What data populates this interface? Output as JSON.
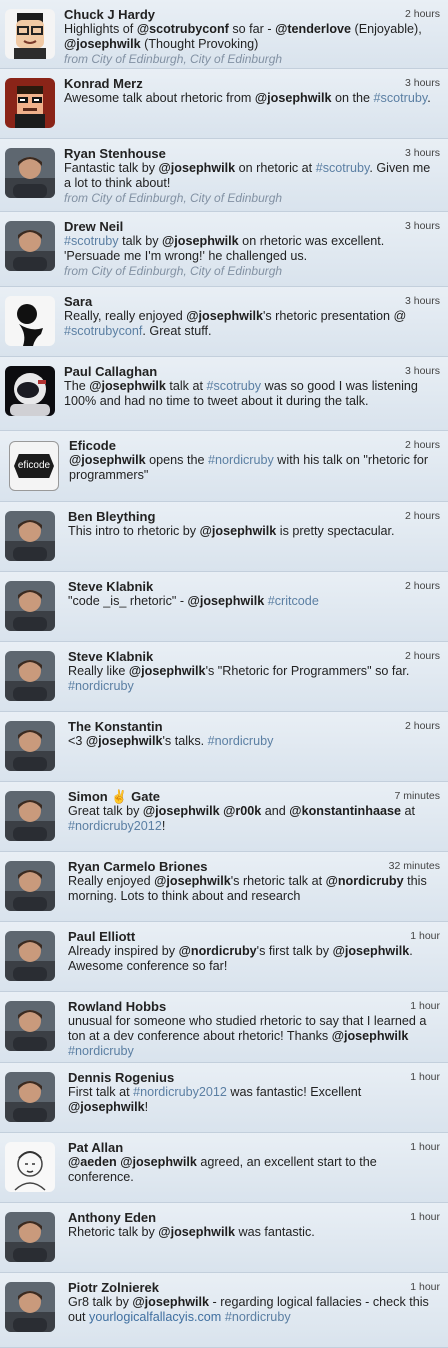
{
  "tweets": [
    {
      "name": "Chuck J Hardy",
      "time": "2 hours",
      "avatar": "cartoon-avatar",
      "h": 69,
      "text": [
        [
          "t",
          "Highlights of "
        ],
        [
          "m",
          "@scotrubyconf"
        ],
        [
          "t",
          " so far - "
        ],
        [
          "m",
          "@tenderlove"
        ],
        [
          "t",
          " (Enjoyable), "
        ],
        [
          "m",
          "@josephwilk"
        ],
        [
          "t",
          " (Thought Provoking)"
        ]
      ],
      "location": "from City of Edinburgh, City of Edinburgh"
    },
    {
      "name": "Konrad Merz",
      "time": "3 hours",
      "avatar": "pixel-art-avatar",
      "h": 70,
      "text": [
        [
          "t",
          "Awesome talk about rhetoric from "
        ],
        [
          "m",
          "@josephwilk"
        ],
        [
          "t",
          " on the "
        ],
        [
          "h",
          "#scotruby"
        ],
        [
          "t",
          "."
        ]
      ]
    },
    {
      "name": "Ryan Stenhouse",
      "time": "3 hours",
      "avatar": "photo-avatar",
      "h": 73,
      "text": [
        [
          "t",
          "Fantastic talk by "
        ],
        [
          "m",
          "@josephwilk"
        ],
        [
          "t",
          " on rhetoric at "
        ],
        [
          "h",
          "#scotruby"
        ],
        [
          "t",
          ". Given me a lot to think about!"
        ]
      ],
      "location": "from City of Edinburgh, City of Edinburgh"
    },
    {
      "name": "Drew Neil",
      "time": "3 hours",
      "avatar": "photo-avatar",
      "h": 75,
      "text": [
        [
          "h",
          "#scotruby"
        ],
        [
          "t",
          " talk by "
        ],
        [
          "m",
          "@josephwilk"
        ],
        [
          "t",
          " on rhetoric was excellent. 'Persuade me I'm wrong!' he challenged us."
        ]
      ],
      "location": "from City of Edinburgh, City of Edinburgh"
    },
    {
      "name": "Sara",
      "time": "3 hours",
      "avatar": "silhouette-avatar",
      "h": 70,
      "text": [
        [
          "t",
          "Really, really enjoyed "
        ],
        [
          "m",
          "@josephwilk"
        ],
        [
          "t",
          "'s rhetoric presentation @ "
        ],
        [
          "h",
          "#scotrubyconf"
        ],
        [
          "t",
          ". Great stuff."
        ]
      ]
    },
    {
      "name": "Paul Callaghan",
      "time": "3 hours",
      "avatar": "helmet-avatar",
      "h": 74,
      "text": [
        [
          "t",
          "The "
        ],
        [
          "m",
          "@josephwilk"
        ],
        [
          "t",
          " talk at "
        ],
        [
          "h",
          "#scotruby"
        ],
        [
          "t",
          " was so good I was listening 100% and had no time to tweet about it during the talk."
        ]
      ]
    },
    {
      "name": "Eficode",
      "time": "2 hours",
      "avatar": "eficode-logo",
      "logo_text": "eficode",
      "h": 71,
      "text": [
        [
          "m",
          "@josephwilk"
        ],
        [
          "t",
          " opens the "
        ],
        [
          "h",
          "#nordicruby"
        ],
        [
          "t",
          " with his talk on \"rhetoric for programmers\""
        ]
      ]
    },
    {
      "name": "Ben Bleything",
      "time": "2 hours",
      "avatar": "photo-avatar",
      "h": 70,
      "text": [
        [
          "t",
          "This intro to rhetoric by "
        ],
        [
          "m",
          "@josephwilk"
        ],
        [
          "t",
          " is pretty spectacular."
        ]
      ]
    },
    {
      "name": "Steve Klabnik",
      "time": "2 hours",
      "avatar": "photo-avatar",
      "h": 70,
      "text": [
        [
          "t",
          "\"code _is_ rhetoric\" - "
        ],
        [
          "m",
          "@josephwilk"
        ],
        [
          "t",
          " "
        ],
        [
          "h",
          "#critcode"
        ]
      ]
    },
    {
      "name": "Steve Klabnik",
      "time": "2 hours",
      "avatar": "photo-avatar",
      "h": 70,
      "text": [
        [
          "t",
          "Really like "
        ],
        [
          "m",
          "@josephwilk"
        ],
        [
          "t",
          "'s \"Rhetoric for Programmers\" so far. "
        ],
        [
          "h",
          "#nordicruby"
        ]
      ]
    },
    {
      "name": "The Konstantin",
      "time": "2 hours",
      "avatar": "photo-avatar",
      "h": 70,
      "text": [
        [
          "t",
          "<3 "
        ],
        [
          "m",
          "@josephwilk"
        ],
        [
          "t",
          "'s talks. "
        ],
        [
          "h",
          "#nordicruby"
        ]
      ]
    },
    {
      "name": "Simon ✌ Gate",
      "time": "7 minutes",
      "avatar": "photo-avatar",
      "h": 70,
      "text": [
        [
          "t",
          "Great talk by "
        ],
        [
          "m",
          "@josephwilk"
        ],
        [
          "t",
          " "
        ],
        [
          "m",
          "@r00k"
        ],
        [
          "t",
          " and "
        ],
        [
          "m",
          "@konstantinhaase"
        ],
        [
          "t",
          " at "
        ],
        [
          "h",
          "#nordicruby2012"
        ],
        [
          "t",
          "!"
        ]
      ]
    },
    {
      "name": "Ryan Carmelo Briones",
      "time": "32 minutes",
      "avatar": "photo-avatar",
      "h": 70,
      "text": [
        [
          "t",
          "Really enjoyed "
        ],
        [
          "m",
          "@josephwilk"
        ],
        [
          "t",
          "'s rhetoric talk at "
        ],
        [
          "m",
          "@nordicruby"
        ],
        [
          "t",
          " this morning. Lots to think about and research"
        ]
      ]
    },
    {
      "name": "Paul Elliott",
      "time": "1 hour",
      "avatar": "photo-avatar",
      "h": 70,
      "text": [
        [
          "t",
          "Already inspired by "
        ],
        [
          "m",
          "@nordicruby"
        ],
        [
          "t",
          "'s first talk by "
        ],
        [
          "m",
          "@josephwilk"
        ],
        [
          "t",
          ". Awesome conference so far!"
        ]
      ]
    },
    {
      "name": "Rowland Hobbs",
      "time": "1 hour",
      "avatar": "photo-avatar",
      "h": 71,
      "text": [
        [
          "t",
          "unusual for someone who studied rhetoric to say that I learned a ton at a dev conference about rhetoric! Thanks "
        ],
        [
          "m",
          "@josephwilk"
        ],
        [
          "t",
          " "
        ],
        [
          "h",
          "#nordicruby"
        ]
      ]
    },
    {
      "name": "Dennis Rogenius",
      "time": "1 hour",
      "avatar": "photo-avatar",
      "h": 70,
      "text": [
        [
          "t",
          "First talk at "
        ],
        [
          "h",
          "#nordicruby2012"
        ],
        [
          "t",
          " was fantastic! Excellent "
        ],
        [
          "m",
          "@josephwilk"
        ],
        [
          "t",
          "!"
        ]
      ]
    },
    {
      "name": "Pat Allan",
      "time": "1 hour",
      "avatar": "sketch-avatar",
      "h": 70,
      "text": [
        [
          "m",
          "@aeden"
        ],
        [
          "t",
          " "
        ],
        [
          "m",
          "@josephwilk"
        ],
        [
          "t",
          " agreed, an excellent start to the conference."
        ]
      ]
    },
    {
      "name": "Anthony Eden",
      "time": "1 hour",
      "avatar": "photo-avatar",
      "h": 70,
      "text": [
        [
          "t",
          "Rhetoric talk by "
        ],
        [
          "m",
          "@josephwilk"
        ],
        [
          "t",
          " was fantastic."
        ]
      ]
    },
    {
      "name": "Piotr Zolnierek",
      "time": "1 hour",
      "avatar": "photo-avatar",
      "h": 75,
      "text": [
        [
          "t",
          "Gr8 talk by "
        ],
        [
          "m",
          "@josephwilk"
        ],
        [
          "t",
          " - regarding logical fallacies - check this out "
        ],
        [
          "l",
          "yourlogicalfallacyis.com"
        ],
        [
          "t",
          " "
        ],
        [
          "h",
          "#nordicruby"
        ]
      ]
    }
  ]
}
